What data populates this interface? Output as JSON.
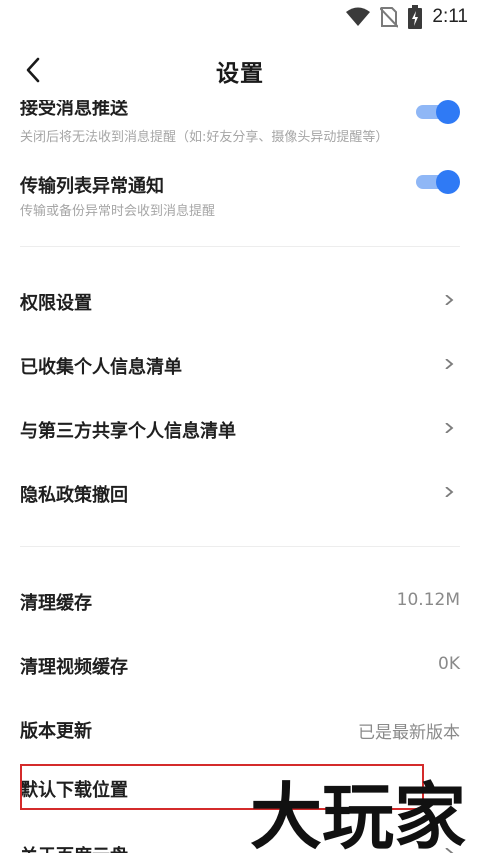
{
  "status_bar": {
    "time": "2:11"
  },
  "header": {
    "title": "设置"
  },
  "notifications": [
    {
      "title": "接受消息推送",
      "subtitle": "关闭后将无法收到消息提醒（如:好友分享、摄像头异动提醒等）",
      "enabled": true
    },
    {
      "title": "传输列表异常通知",
      "subtitle": "传输或备份异常时会收到消息提醒",
      "enabled": true
    }
  ],
  "privacy_items": [
    {
      "label": "权限设置"
    },
    {
      "label": "已收集个人信息清单"
    },
    {
      "label": "与第三方共享个人信息清单"
    },
    {
      "label": "隐私政策撤回"
    }
  ],
  "general_items": [
    {
      "label": "清理缓存",
      "value": "10.12M"
    },
    {
      "label": "清理视频缓存",
      "value": "0K"
    },
    {
      "label": "版本更新",
      "value": "已是最新版本"
    },
    {
      "label": "默认下载位置"
    },
    {
      "label": "关于百度云盘"
    }
  ],
  "watermark": {
    "text": "大玩家"
  },
  "colors": {
    "accent": "#2f7af5",
    "highlight_border": "#d42b2b"
  }
}
